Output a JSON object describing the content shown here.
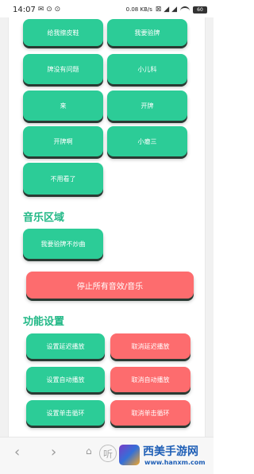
{
  "status_bar": {
    "time": "14:07",
    "net_speed": "0.08 KB/s",
    "battery": "60"
  },
  "top_buttons": [
    {
      "label": "给我擦皮鞋",
      "color": "green"
    },
    {
      "label": "我要验牌",
      "color": "green"
    },
    {
      "label": "牌没有问题",
      "color": "green"
    },
    {
      "label": "小儿科",
      "color": "green"
    },
    {
      "label": "来",
      "color": "green"
    },
    {
      "label": "开牌",
      "color": "green"
    },
    {
      "label": "开牌啊",
      "color": "green"
    },
    {
      "label": "小瘪三",
      "color": "green"
    },
    {
      "label": "不用看了",
      "color": "green"
    }
  ],
  "music_section": {
    "title": "音乐区域",
    "buttons": [
      {
        "label": "我要验牌不炒曲"
      }
    ]
  },
  "stop_all_label": "停止所有音效/音乐",
  "function_section": {
    "title": "功能设置",
    "rows": [
      {
        "left": "设置延迟播放",
        "right": "取消延迟播放"
      },
      {
        "left": "设置自动播放",
        "right": "取消自动播放"
      },
      {
        "left": "设置单击循环",
        "right": "取消单击循环"
      }
    ]
  },
  "watermark": {
    "ting": "听",
    "title": "西美手游网",
    "url": "www.hanxm.com"
  },
  "colors": {
    "green": "#2ccc97",
    "red": "#fd6c6e",
    "section_title": "#21b886"
  }
}
